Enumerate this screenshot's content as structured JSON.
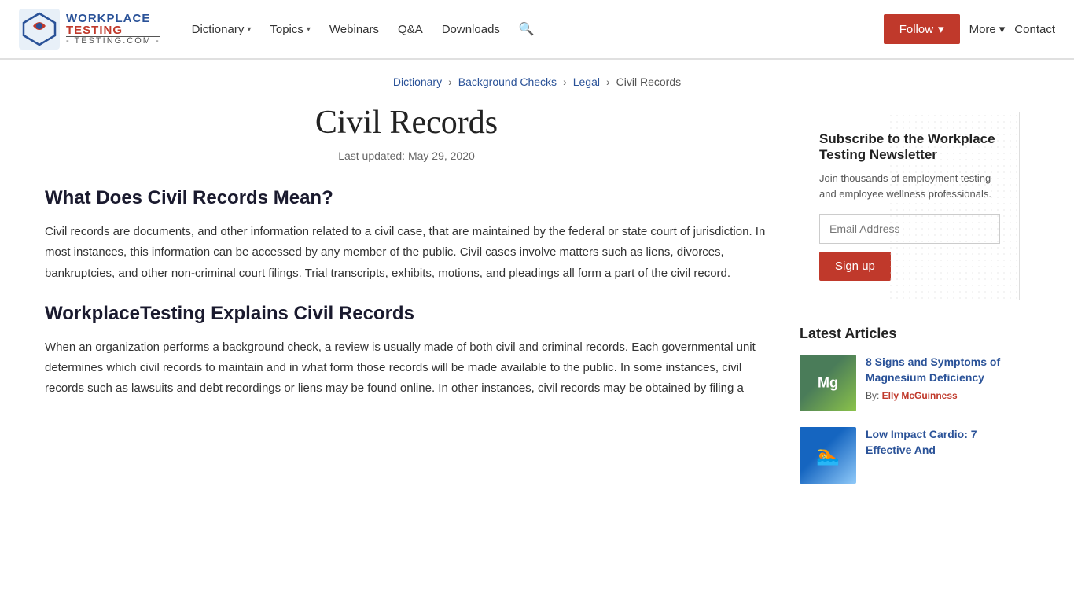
{
  "header": {
    "logo": {
      "workplace": "WORKPLACE",
      "testing": "TESTING",
      "com": "- TESTING.COM -"
    },
    "nav": [
      {
        "label": "Dictionary",
        "hasArrow": true,
        "name": "nav-dictionary"
      },
      {
        "label": "Topics",
        "hasArrow": true,
        "name": "nav-topics"
      },
      {
        "label": "Webinars",
        "hasArrow": false,
        "name": "nav-webinars"
      },
      {
        "label": "Q&A",
        "hasArrow": false,
        "name": "nav-qa"
      },
      {
        "label": "Downloads",
        "hasArrow": false,
        "name": "nav-downloads"
      }
    ],
    "follow_label": "Follow",
    "more_label": "More",
    "contact_label": "Contact"
  },
  "breadcrumb": {
    "items": [
      {
        "label": "Dictionary",
        "link": true
      },
      {
        "label": "Background Checks",
        "link": true
      },
      {
        "label": "Legal",
        "link": true
      },
      {
        "label": "Civil Records",
        "link": false
      }
    ]
  },
  "page": {
    "title": "Civil Records",
    "last_updated": "Last updated: May 29, 2020",
    "sections": [
      {
        "heading": "What Does Civil Records Mean?",
        "text": "Civil records are documents, and other information related to a civil case, that are maintained by the federal or state court of jurisdiction. In most instances, this information can be accessed by any member of the public. Civil cases involve matters such as liens, divorces, bankruptcies, and other non-criminal court filings. Trial transcripts, exhibits, motions, and pleadings all form a part of the civil record."
      },
      {
        "heading": "WorkplaceTesting Explains Civil Records",
        "text": "When an organization performs a background check, a review is usually made of both civil and criminal records. Each governmental unit determines which civil records to maintain and in what form those records will be made available to the public. In some instances, civil records such as lawsuits and debt recordings or liens may be found online. In other instances, civil records may be obtained by filing a"
      }
    ]
  },
  "sidebar": {
    "newsletter": {
      "title": "Subscribe to the Workplace Testing Newsletter",
      "description": "Join thousands of employment testing and employee wellness professionals.",
      "email_placeholder": "Email Address",
      "signup_label": "Sign up"
    },
    "latest_articles": {
      "title": "Latest Articles",
      "articles": [
        {
          "title": "8 Signs and Symptoms of Magnesium Deficiency",
          "author_prefix": "By:",
          "author": "Elly McGuinness",
          "thumb_class": "thumb-1"
        },
        {
          "title": "Low Impact Cardio: 7 Effective And",
          "author_prefix": "",
          "author": "",
          "thumb_class": "thumb-2"
        }
      ]
    }
  }
}
